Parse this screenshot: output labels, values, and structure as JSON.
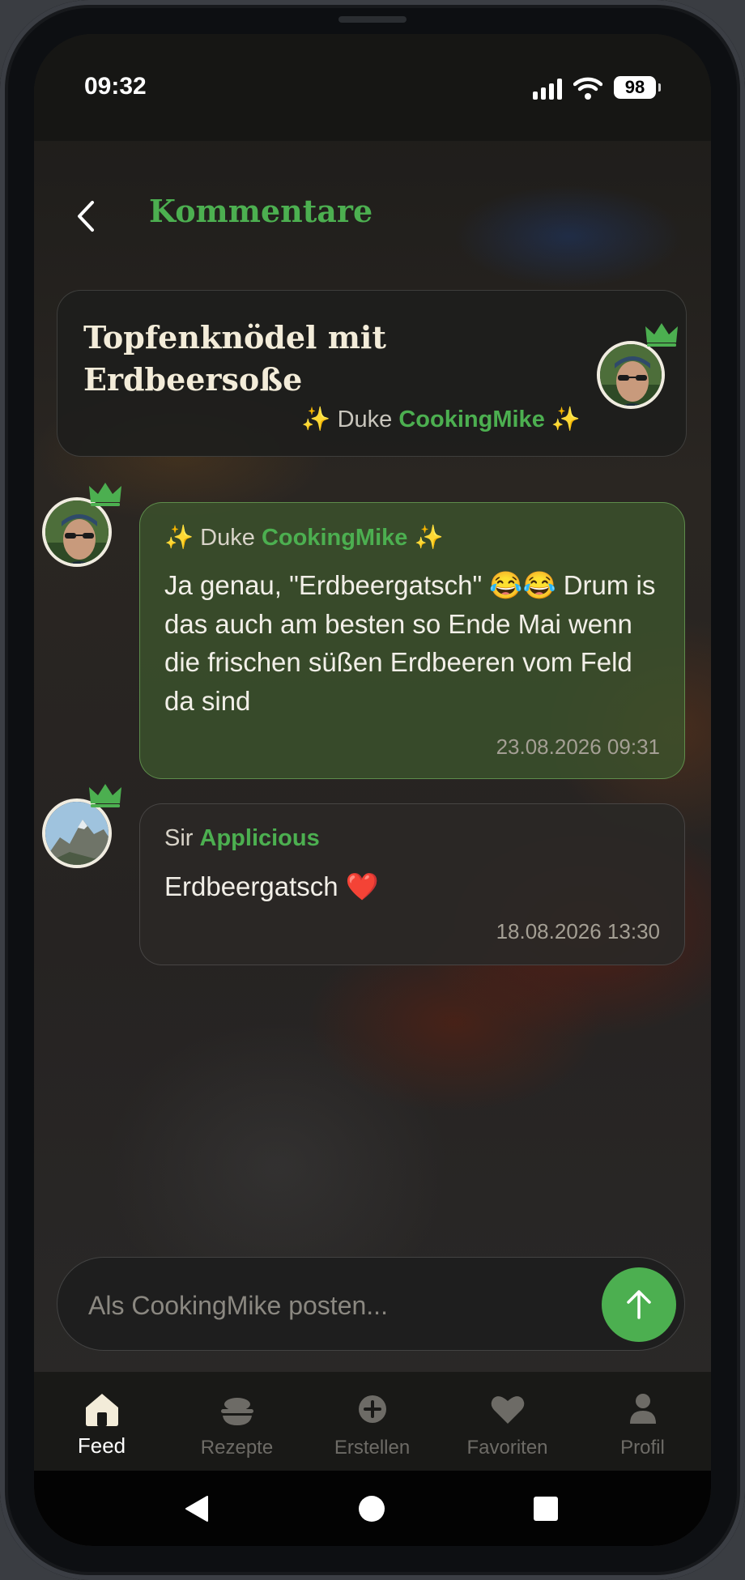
{
  "status_bar": {
    "time": "09:32",
    "battery": "98"
  },
  "header": {
    "title": "Kommentare"
  },
  "recipe": {
    "title": "Topfenknödel mit Erdbeersoße",
    "author_prefix": "✨ Duke",
    "author_name": "CookingMike",
    "author_suffix": "✨"
  },
  "comments": [
    {
      "prefix": "✨ Duke",
      "name": "CookingMike",
      "suffix": "✨",
      "text": "Ja genau, \"Erdbeergatsch\" 😂😂 Drum is das auch am besten so Ende Mai wenn die frischen süßen Erdbeeren vom Feld da sind",
      "date": "23.08.2026 09:31"
    },
    {
      "prefix": "Sir",
      "name": "Applicious",
      "suffix": "",
      "text": "Erdbeergatsch ❤️",
      "date": "18.08.2026 13:30"
    }
  ],
  "composer": {
    "placeholder": "Als CookingMike posten..."
  },
  "nav": {
    "items": [
      {
        "label": "Feed",
        "icon": "home-icon",
        "active": true
      },
      {
        "label": "Rezepte",
        "icon": "bowl-icon",
        "active": false
      },
      {
        "label": "Erstellen",
        "icon": "plus-circle-icon",
        "active": false
      },
      {
        "label": "Favoriten",
        "icon": "heart-icon",
        "active": false
      },
      {
        "label": "Profil",
        "icon": "person-icon",
        "active": false
      }
    ]
  },
  "colors": {
    "accent": "#4caf50",
    "cream": "#f3ecd9",
    "background": "#1f1e1c"
  }
}
